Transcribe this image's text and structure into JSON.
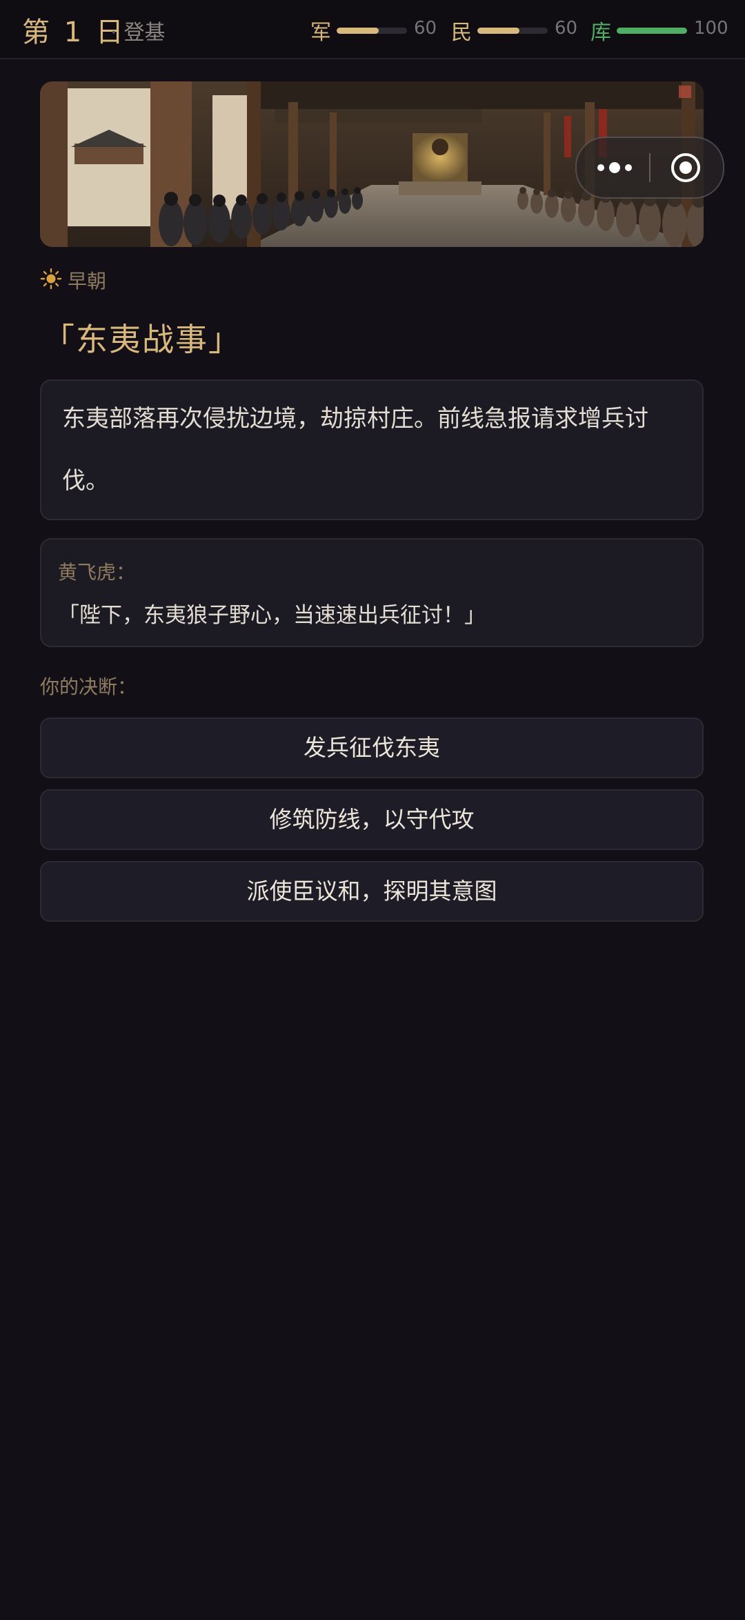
{
  "header": {
    "day": "第 1 日",
    "era_separator": "·",
    "era": "登基",
    "stats": {
      "army": {
        "label": "军",
        "value": "60",
        "level": 0.6,
        "color": "#d9b979"
      },
      "people": {
        "label": "民",
        "value": "60",
        "level": 0.6,
        "color": "#d9b979"
      },
      "treasury": {
        "label": "库",
        "value": "100",
        "level": 1.0,
        "color": "#4caf62"
      }
    }
  },
  "capsule": {
    "more_icon": "more-dots-icon",
    "close_icon": "target-circle-icon"
  },
  "event": {
    "session": "早朝",
    "session_icon": "sun-icon",
    "title": "「东夷战事」",
    "description": "东夷部落再次侵扰边境，劫掠村庄。前线急报请求增兵讨伐。",
    "speaker": "黄飞虎：",
    "quote": "「陛下，东夷狼子野心，当速速出兵征讨！」"
  },
  "decision": {
    "prompt": "你的决断：",
    "choices": [
      "发兵征伐东夷",
      "修筑防线，以守代攻",
      "派使臣议和，探明其意图"
    ]
  },
  "colors": {
    "background": "#121016",
    "accent_gold": "#d9b979",
    "accent_green": "#4caf62",
    "muted_gold": "#8f7c5e"
  }
}
